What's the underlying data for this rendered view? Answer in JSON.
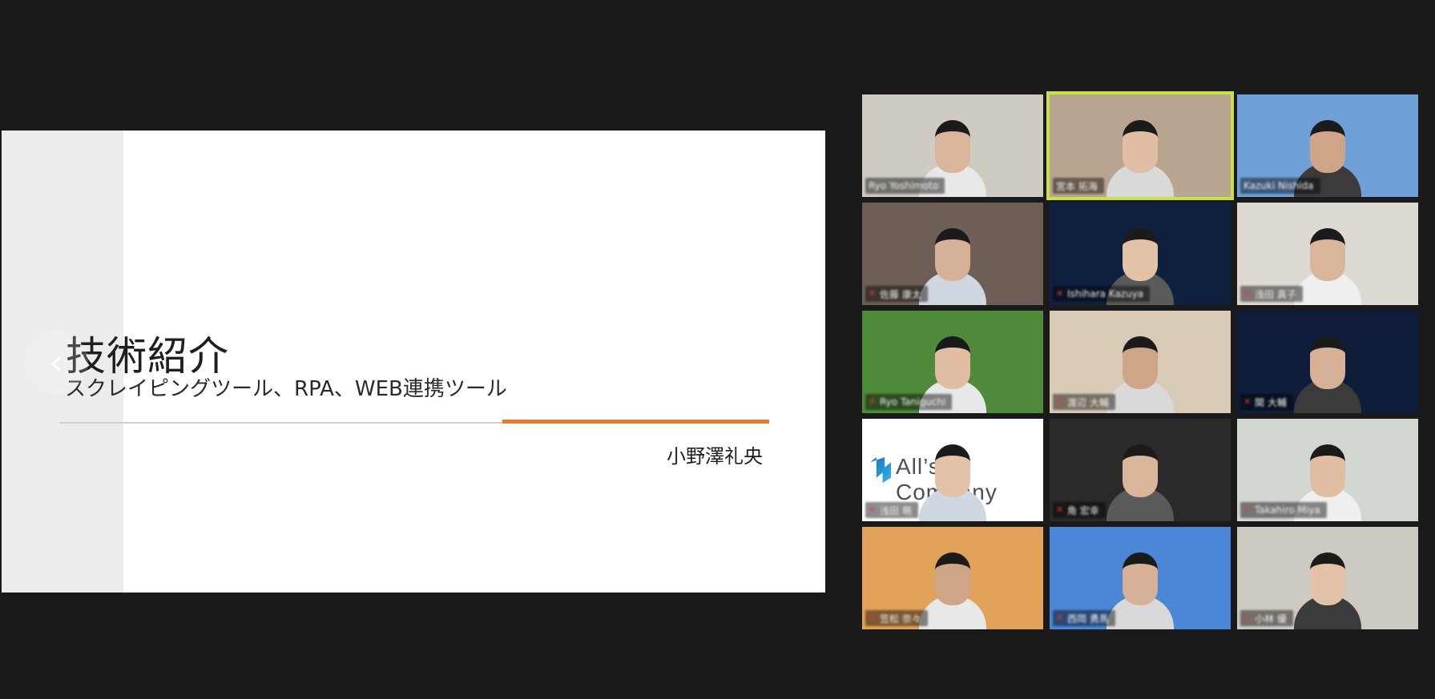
{
  "slide": {
    "title": "技術紹介",
    "subtitle": "スクレイピングツール、RPA、WEB連携ツール",
    "presenter": "小野澤礼央"
  },
  "navigation": {
    "prev_icon": "chevron-left-icon",
    "next_icon": "chevron-right-icon",
    "prev_glyph": "‹",
    "next_glyph": "›"
  },
  "gallery": {
    "active_speaker_color": "#c8e04a",
    "tiles": [
      {
        "name_label": "Ryo Yoshimoto",
        "muted": false,
        "bg": "#cfcac2"
      },
      {
        "name_label": "宮本 拓海",
        "muted": false,
        "bg": "#b9a58f",
        "active": true
      },
      {
        "name_label": "Kazuki Nishida",
        "muted": false,
        "bg": "#6fa0d8"
      },
      {
        "name_label": "佐藤 康太",
        "muted": true,
        "bg": "#6d5f55"
      },
      {
        "name_label": "Ishihara Kazuya",
        "muted": true,
        "bg": "#102140"
      },
      {
        "name_label": "浅田 真子",
        "muted": true,
        "bg": "#ded9d3"
      },
      {
        "name_label": "Ryo Taniguchi",
        "muted": true,
        "bg": "#4f8a3a"
      },
      {
        "name_label": "渡辺 大輔",
        "muted": true,
        "bg": "#d8cbb5"
      },
      {
        "name_label": "関 大輔",
        "muted": true,
        "bg": "#0f1d3a"
      },
      {
        "name_label": "浅田 萌",
        "muted": true,
        "bg": "#ffffff",
        "logo": "All’s Company"
      },
      {
        "name_label": "角 宏幸",
        "muted": true,
        "bg": "#2a2a2a"
      },
      {
        "name_label": "Takahiro Miya",
        "muted": true,
        "bg": "#d3d7d1"
      },
      {
        "name_label": "笠松 奈々",
        "muted": true,
        "bg": "#e2a25a"
      },
      {
        "name_label": "西岡 勇馬",
        "muted": true,
        "bg": "#4b87d6"
      },
      {
        "name_label": "小林 優",
        "muted": true,
        "bg": "#cfcac1"
      }
    ]
  }
}
